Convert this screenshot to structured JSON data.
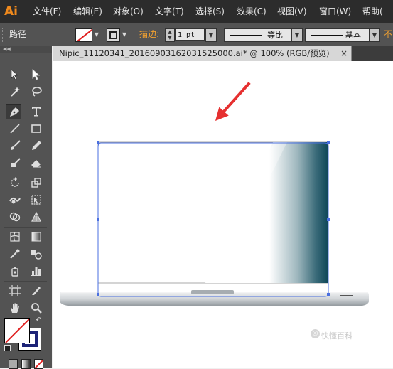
{
  "app": {
    "logo": "Ai"
  },
  "menu": [
    {
      "label": "文件(F)"
    },
    {
      "label": "编辑(E)"
    },
    {
      "label": "对象(O)"
    },
    {
      "label": "文字(T)"
    },
    {
      "label": "选择(S)"
    },
    {
      "label": "效果(C)"
    },
    {
      "label": "视图(V)"
    },
    {
      "label": "窗口(W)"
    },
    {
      "label": "帮助("
    }
  ],
  "control_bar": {
    "selection_type": "路径",
    "stroke_label": "描边:",
    "stroke_weight": "1 pt",
    "variable_width_profile": "等比",
    "brush_definition": "基本",
    "opacity_label": "不"
  },
  "document": {
    "tab_title": "Nipic_11120341_20160903162031525000.ai* @ 100% (RGB/预览)",
    "close_glyph": "×"
  },
  "tools": [
    {
      "icon": "selection-tool-icon"
    },
    {
      "icon": "direct-selection-tool-icon"
    },
    {
      "icon": "magic-wand-tool-icon"
    },
    {
      "icon": "lasso-tool-icon"
    },
    {
      "icon": "pen-tool-icon"
    },
    {
      "icon": "type-tool-icon"
    },
    {
      "icon": "line-segment-tool-icon"
    },
    {
      "icon": "rectangle-tool-icon"
    },
    {
      "icon": "paintbrush-tool-icon"
    },
    {
      "icon": "pencil-tool-icon"
    },
    {
      "icon": "blob-brush-tool-icon"
    },
    {
      "icon": "eraser-tool-icon"
    },
    {
      "icon": "rotate-tool-icon"
    },
    {
      "icon": "scale-tool-icon"
    },
    {
      "icon": "warp-tool-icon"
    },
    {
      "icon": "free-transform-tool-icon"
    },
    {
      "icon": "shape-builder-tool-icon"
    },
    {
      "icon": "perspective-grid-tool-icon"
    },
    {
      "icon": "mesh-tool-icon"
    },
    {
      "icon": "gradient-tool-icon"
    },
    {
      "icon": "eyedropper-tool-icon"
    },
    {
      "icon": "blend-tool-icon"
    },
    {
      "icon": "symbol-sprayer-tool-icon"
    },
    {
      "icon": "column-graph-tool-icon"
    },
    {
      "icon": "artboard-tool-icon"
    },
    {
      "icon": "slice-tool-icon"
    },
    {
      "icon": "hand-tool-icon"
    },
    {
      "icon": "zoom-tool-icon"
    }
  ],
  "colors": {
    "menubar_bg": "#2c2c2c",
    "panel_bg": "#535353",
    "logo": "#f08a1d",
    "highlight_label": "#f0a030",
    "selection": "#4a6fe0",
    "arrow": "#e63030",
    "gradient_dark": "#0d4657"
  },
  "watermark": "快懂百科"
}
